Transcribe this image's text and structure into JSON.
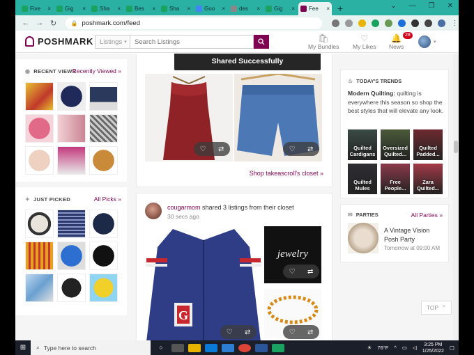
{
  "browser": {
    "tabs": [
      {
        "label": "Five",
        "color": "#1aa260"
      },
      {
        "label": "Gig",
        "color": "#1aa260"
      },
      {
        "label": "Sha",
        "color": "#1aa260"
      },
      {
        "label": "Bes",
        "color": "#1aa260"
      },
      {
        "label": "Sha",
        "color": "#1aa260"
      },
      {
        "label": "Goo",
        "color": "#4285f4"
      },
      {
        "label": "des",
        "color": "#888888"
      },
      {
        "label": "Gig",
        "color": "#1aa260"
      },
      {
        "label": "Fee",
        "color": "#7f0353",
        "active": true
      }
    ],
    "new_tab": "+",
    "url": "poshmark.com/feed"
  },
  "header": {
    "logo": "POSHMARK",
    "search_category": "Listings",
    "search_placeholder": "Search Listings",
    "nav": {
      "bundles": "My Bundles",
      "likes": "My Likes",
      "news": "News",
      "news_count": "28"
    }
  },
  "sidebar": {
    "recent_title": "RECENT VIEWS",
    "recent_link": "Recently Viewed »",
    "just_picked_title": "JUST PICKED",
    "just_picked_link": "All Picks »"
  },
  "feed": {
    "toast": "Shared Successfully",
    "shop_link": "Shop takeascroll's closet »",
    "seller": "cougarmom",
    "seller_action": " shared 3 listings from their closet",
    "seller_time": "30 secs ago",
    "jewelry_text": "jewelry"
  },
  "trends": {
    "title": "TODAY'S TRENDS",
    "headline": "Modern Quilting:",
    "body": " quilting is everywhere this season so shop the best styles that will elevate any look.",
    "tiles": [
      {
        "label": "Quilted Cardigans",
        "color": "#3a4a44"
      },
      {
        "label": "Oversized Quilted...",
        "color": "#4b5a3a"
      },
      {
        "label": "Quilted Padded...",
        "color": "#6d2a2f"
      },
      {
        "label": "Quilted Mules",
        "color": "#2e2e33"
      },
      {
        "label": "Free People...",
        "color": "#8a3a4a"
      },
      {
        "label": "Zara Quilted...",
        "color": "#a33a48"
      }
    ]
  },
  "parties": {
    "title": "PARTIES",
    "link": "All Parties »",
    "party_title": "A Vintage Vision Posh Party",
    "party_time": "Tomorrow at 09:00 AM"
  },
  "top_button": "TOP",
  "taskbar": {
    "search": "Type here to search",
    "weather": "76°F",
    "time": "3:25 PM",
    "date": "1/25/2022"
  }
}
